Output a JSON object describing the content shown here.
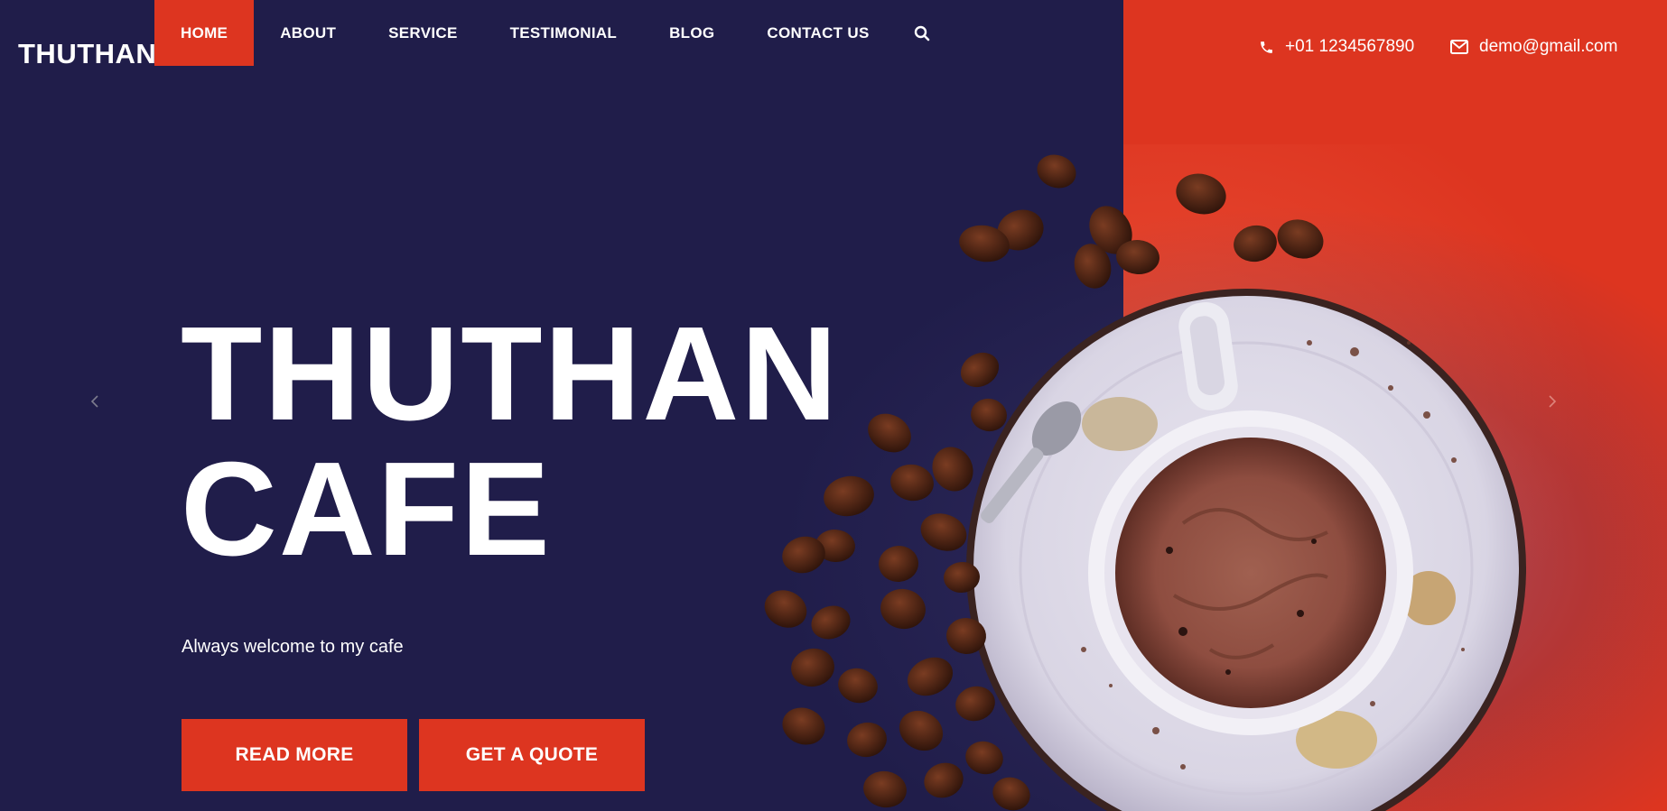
{
  "brand": {
    "logo": "THUTHAN"
  },
  "nav": {
    "items": [
      {
        "label": "HOME",
        "active": true
      },
      {
        "label": "ABOUT",
        "active": false
      },
      {
        "label": "SERVICE",
        "active": false
      },
      {
        "label": "TESTIMONIAL",
        "active": false
      },
      {
        "label": "BLOG",
        "active": false
      },
      {
        "label": "CONTACT US",
        "active": false
      }
    ],
    "search_icon": "search-icon"
  },
  "contact": {
    "phone": "+01 1234567890",
    "email": "demo@gmail.com",
    "phone_icon": "phone-icon",
    "email_icon": "envelope-icon"
  },
  "hero": {
    "title_line1": "THUTHAN",
    "title_line2": "CAFE",
    "subtitle": "Always welcome to my cafe",
    "primary_button": "READ MORE",
    "secondary_button": "GET A QUOTE"
  },
  "slider": {
    "prev_icon": "chevron-left-icon",
    "next_icon": "chevron-right-icon"
  },
  "colors": {
    "navy": "#201d4a",
    "accent": "#dd3520",
    "text": "#ffffff"
  }
}
